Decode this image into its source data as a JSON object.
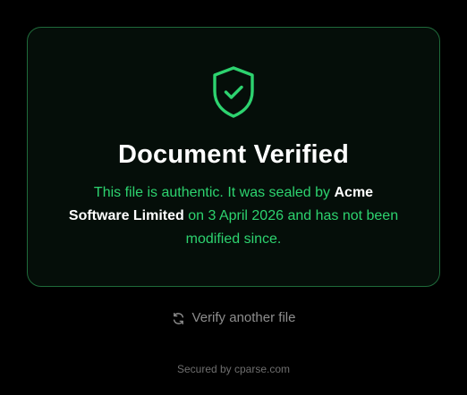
{
  "colors": {
    "background": "#000000",
    "card_background": "#050e09",
    "card_border": "#1f6a3a",
    "accent_green": "#2dd36f",
    "heading": "#ffffff",
    "muted": "#8d8d8d"
  },
  "status": {
    "icon": "shield-check-icon",
    "title": "Document Verified",
    "message": {
      "part1": "This file is authentic. It was sealed by ",
      "issuer": "Acme Software Limited",
      "part2": " on 3 April 2026 and has not been modified since."
    }
  },
  "actions": {
    "verify_another": {
      "label": "Verify another file",
      "icon": "refresh-icon"
    }
  },
  "footer": {
    "text": "Secured by cparse.com"
  }
}
